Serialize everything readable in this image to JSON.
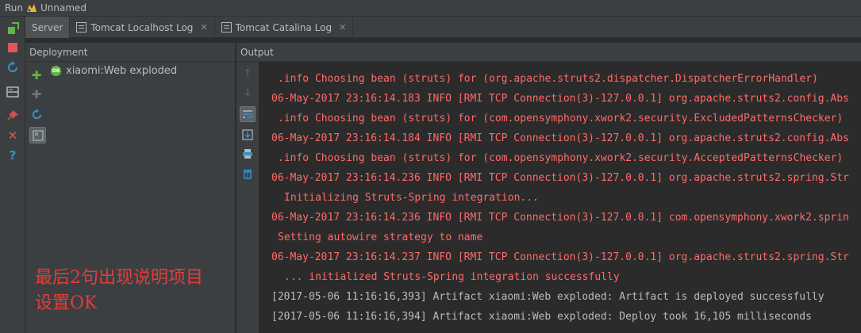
{
  "titlebar": {
    "run_label": "Run",
    "config_name": "Unnamed"
  },
  "tabs": [
    {
      "label": "Server",
      "active": true,
      "closable": false
    },
    {
      "label": "Tomcat Localhost Log",
      "active": false,
      "closable": true
    },
    {
      "label": "Tomcat Catalina Log",
      "active": false,
      "closable": true
    }
  ],
  "deployment": {
    "header": "Deployment",
    "artifact": {
      "name": "xiaomi:Web exploded",
      "status_badge": "OK"
    },
    "annotation_lines": [
      "最后2句出现说明项目",
      "设置OK"
    ]
  },
  "output": {
    "header": "Output",
    "lines": [
      {
        "text": ".info Choosing bean (struts) for (org.apache.struts2.dispatcher.DispatcherErrorHandler)",
        "style": "err",
        "indent": 1
      },
      {
        "text": "06-May-2017 23:16:14.183 INFO [RMI TCP Connection(3)-127.0.0.1] org.apache.struts2.config.Abs",
        "style": "err",
        "indent": 0
      },
      {
        "text": ".info Choosing bean (struts) for (com.opensymphony.xwork2.security.ExcludedPatternsChecker)",
        "style": "err",
        "indent": 1
      },
      {
        "text": "06-May-2017 23:16:14.184 INFO [RMI TCP Connection(3)-127.0.0.1] org.apache.struts2.config.Abs",
        "style": "err",
        "indent": 0
      },
      {
        "text": ".info Choosing bean (struts) for (com.opensymphony.xwork2.security.AcceptedPatternsChecker)",
        "style": "err",
        "indent": 1
      },
      {
        "text": "06-May-2017 23:16:14.236 INFO [RMI TCP Connection(3)-127.0.0.1] org.apache.struts2.spring.Str",
        "style": "err",
        "indent": 0
      },
      {
        "text": "Initializing Struts-Spring integration...",
        "style": "err",
        "indent": 2
      },
      {
        "text": "06-May-2017 23:16:14.236 INFO [RMI TCP Connection(3)-127.0.0.1] com.opensymphony.xwork2.sprin",
        "style": "err",
        "indent": 0
      },
      {
        "text": "Setting autowire strategy to name",
        "style": "err",
        "indent": 1
      },
      {
        "text": "06-May-2017 23:16:14.237 INFO [RMI TCP Connection(3)-127.0.0.1] org.apache.struts2.spring.Str",
        "style": "err",
        "indent": 0
      },
      {
        "text": "... initialized Struts-Spring integration successfully",
        "style": "err",
        "indent": 2
      },
      {
        "text": "[2017-05-06 11:16:16,393] Artifact xiaomi:Web exploded: Artifact is deployed successfully",
        "style": "std",
        "indent": 0
      },
      {
        "text": "[2017-05-06 11:16:16,394] Artifact xiaomi:Web exploded: Deploy took 16,105 milliseconds",
        "style": "std",
        "indent": 0
      }
    ]
  },
  "colors": {
    "error_text": "#ff6b68",
    "normal_text": "#bbbbbb",
    "annotation": "#e43c3c",
    "run_green": "#62b543",
    "stop_red": "#e05555",
    "action_blue": "#3592c4"
  },
  "icons": {
    "left_toolbar": [
      "rerun-icon",
      "stop-icon",
      "restart-icon",
      "layout-icon",
      "pin-icon",
      "close-icon",
      "help-icon"
    ],
    "deployment_toolbar": [
      "deploy-add-icon",
      "undeploy-icon",
      "redeploy-icon",
      "artifact-select-icon"
    ],
    "output_toolbar": [
      "scroll-up-icon",
      "scroll-down-icon",
      "soft-wrap-icon",
      "scroll-to-end-icon",
      "print-icon",
      "clear-all-icon"
    ]
  }
}
